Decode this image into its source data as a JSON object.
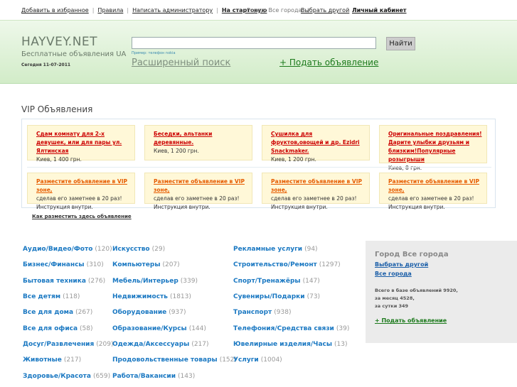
{
  "topbar": {
    "links": [
      "Добавить в избранное",
      "Правила",
      "Написать администратору",
      "На стартовую"
    ],
    "city_label": "Город: Все города",
    "city_change": "Выбрать другой",
    "cabinet": "Личный кабинет"
  },
  "header": {
    "logo": "HAYVEY.NET",
    "tagline": "Бесплатные объявления UA",
    "date": "Сегодня 11-07-2011",
    "search_placeholder": "",
    "search_button": "Найти",
    "example": "Пример: телефон nokia",
    "advanced_search": "Расширенный поиск",
    "add_ad": "+ Подать объявление"
  },
  "vip": {
    "title": "VIP Объявления",
    "ads": [
      {
        "title": "Сдам комнату для 2-х девушек, или для пары ул. Ялтинская",
        "price": "Киев, 1 400 грн."
      },
      {
        "title": "Беседки, альтанки деревянные.",
        "price": "Киев, 1 200 грн."
      },
      {
        "title": "Сушилка для фруктов,овощей и др. Ezidri Snackmaker.",
        "price": "Киев, 1 200 грн."
      },
      {
        "title": "Оригинальные поздравления! Дарите улыбки друзьям и близким!Популярные розыгрыши",
        "price": "Киев, 8 грн."
      }
    ],
    "promos": [
      {
        "title": "Разместите объявление в VIP зоне,",
        "line1": "сделав его заметнее в 20 раз!",
        "line2": "Инструкция внутри."
      },
      {
        "title": "Разместите объявление в VIP зоне,",
        "line1": "сделав его заметнее в 20 раз!",
        "line2": "Инструкция внутри."
      },
      {
        "title": "Разместите объявление в VIP зоне,",
        "line1": "сделав его заметнее в 20 раз!",
        "line2": "Инструкция внутри."
      },
      {
        "title": "Разместите объявление в VIP зоне,",
        "line1": "сделав его заметнее в 20 раз!",
        "line2": "Инструкция внутри."
      }
    ],
    "how": "Как разместить здесь объявление"
  },
  "categories": {
    "col1": [
      {
        "name": "Аудио/Видео/Фото",
        "count": "(120)"
      },
      {
        "name": "Бизнес/Финансы",
        "count": "(310)"
      },
      {
        "name": "Бытовая техника",
        "count": "(276)"
      },
      {
        "name": "Все детям",
        "count": "(118)"
      },
      {
        "name": "Все для дома",
        "count": "(267)"
      },
      {
        "name": "Все для офиса",
        "count": "(58)"
      },
      {
        "name": "Досуг/Развлечения",
        "count": "(209)"
      },
      {
        "name": "Животные",
        "count": "(217)"
      },
      {
        "name": "Здоровье/Красота",
        "count": "(659)"
      }
    ],
    "col2": [
      {
        "name": "Искусство",
        "count": "(29)"
      },
      {
        "name": "Компьютеры",
        "count": "(207)"
      },
      {
        "name": "Мебель/Интерьер",
        "count": "(339)"
      },
      {
        "name": "Недвижимость",
        "count": "(1813)"
      },
      {
        "name": "Оборудование",
        "count": "(937)"
      },
      {
        "name": "Образование/Курсы",
        "count": "(144)"
      },
      {
        "name": "Одежда/Аксессуары",
        "count": "(217)"
      },
      {
        "name": "Продовольственные товары",
        "count": "(152)"
      },
      {
        "name": "Работа/Вакансии",
        "count": "(143)"
      }
    ],
    "col3": [
      {
        "name": "Рекламные услуги",
        "count": "(94)"
      },
      {
        "name": "Строительство/Ремонт",
        "count": "(1297)"
      },
      {
        "name": "Спорт/Тренажёры",
        "count": "(147)"
      },
      {
        "name": "Сувениры/Подарки",
        "count": "(73)"
      },
      {
        "name": "Транспорт",
        "count": "(938)"
      },
      {
        "name": "Телефония/Средства связи",
        "count": "(39)"
      },
      {
        "name": "Ювелирные изделия/Часы",
        "count": "(13)"
      },
      {
        "name": "Услуги",
        "count": "(1004)"
      }
    ]
  },
  "sidebar": {
    "heading": "Город Все города",
    "choose_other": "Выбрать другой",
    "all_cities": "Все города",
    "stat1": "Всего в базе объявлений 9920,",
    "stat2": "за месяц 4528,",
    "stat3": "за сутки 349",
    "add": "+ Подать объявление"
  }
}
